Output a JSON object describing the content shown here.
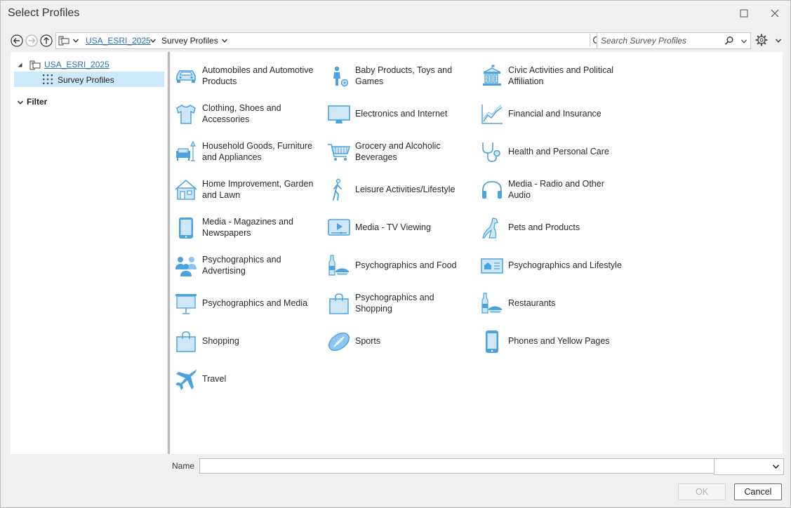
{
  "window": {
    "title": "Select Profiles"
  },
  "nav": {
    "breadcrumb_root": "USA_ESRI_2025",
    "breadcrumb_current": "Survey Profiles",
    "search_placeholder": "Search Survey Profiles"
  },
  "tree": {
    "root_label": "USA_ESRI_2025",
    "selected_label": "Survey Profiles",
    "filter_label": "Filter"
  },
  "profiles": [
    {
      "label": "Automobiles and Automotive Products",
      "icon": "car-icon"
    },
    {
      "label": "Baby Products, Toys and Games",
      "icon": "baby-icon"
    },
    {
      "label": "Civic Activities and Political Affiliation",
      "icon": "capitol-icon"
    },
    {
      "label": "Clothing, Shoes and Accessories",
      "icon": "shirt-icon"
    },
    {
      "label": "Electronics and Internet",
      "icon": "monitor-icon"
    },
    {
      "label": "Financial and Insurance",
      "icon": "line-chart-icon"
    },
    {
      "label": "Household Goods, Furniture and Appliances",
      "icon": "sofa-lamp-icon"
    },
    {
      "label": "Grocery and Alcoholic Beverages",
      "icon": "shopping-cart-icon"
    },
    {
      "label": "Health and Personal Care",
      "icon": "stethoscope-icon"
    },
    {
      "label": "Home Improvement, Garden and Lawn",
      "icon": "house-icon"
    },
    {
      "label": "Leisure Activities/Lifestyle",
      "icon": "walking-person-icon"
    },
    {
      "label": "Media - Radio and Other Audio",
      "icon": "headphones-icon"
    },
    {
      "label": "Media - Magazines and Newspapers",
      "icon": "tablet-icon"
    },
    {
      "label": "Media - TV Viewing",
      "icon": "tv-play-icon"
    },
    {
      "label": "Pets and Products",
      "icon": "dog-icon"
    },
    {
      "label": "Psychographics and Advertising",
      "icon": "people-icon"
    },
    {
      "label": "Psychographics and Food",
      "icon": "food-bottle-icon"
    },
    {
      "label": "Psychographics and Lifestyle",
      "icon": "id-card-icon"
    },
    {
      "label": "Psychographics and Media",
      "icon": "projector-screen-icon"
    },
    {
      "label": "Psychographics and Shopping",
      "icon": "shopping-bag-icon"
    },
    {
      "label": "Restaurants",
      "icon": "food-bottle-icon"
    },
    {
      "label": "Shopping",
      "icon": "shopping-bag-icon"
    },
    {
      "label": "Sports",
      "icon": "football-icon"
    },
    {
      "label": "Phones and Yellow Pages",
      "icon": "phone-icon"
    },
    {
      "label": "Travel",
      "icon": "airplane-icon"
    }
  ],
  "footer": {
    "name_label": "Name",
    "name_value": "",
    "type_value": "",
    "ok_label": "OK",
    "cancel_label": "Cancel"
  },
  "colors": {
    "icon_blue": "#4aa3df",
    "icon_fill": "#cfe6f7",
    "selection": "#cde8f8",
    "link": "#2b6fb6"
  }
}
